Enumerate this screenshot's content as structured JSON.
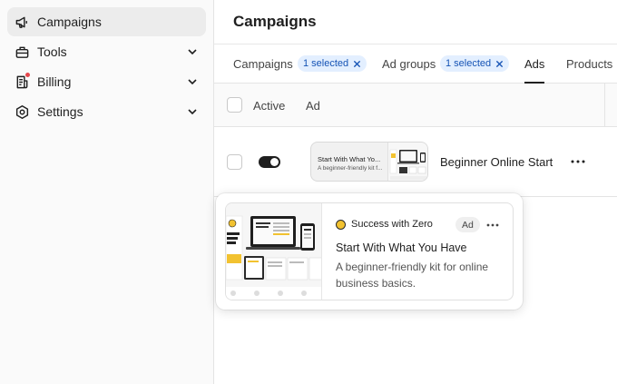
{
  "sidebar": {
    "items": [
      {
        "label": "Campaigns",
        "icon": "megaphone-icon",
        "active": true
      },
      {
        "label": "Tools",
        "icon": "toolbox-icon",
        "expandable": true
      },
      {
        "label": "Billing",
        "icon": "receipt-icon",
        "expandable": true,
        "has_notification": true
      },
      {
        "label": "Settings",
        "icon": "gear-icon",
        "expandable": true
      }
    ]
  },
  "main": {
    "title": "Campaigns",
    "tabs": [
      {
        "label": "Campaigns",
        "chip": "1 selected"
      },
      {
        "label": "Ad groups",
        "chip": "1 selected"
      },
      {
        "label": "Ads",
        "active": true
      },
      {
        "label": "Products"
      }
    ],
    "table": {
      "columns": [
        "Active",
        "Ad"
      ],
      "rows": [
        {
          "active": true,
          "thumb_title": "Start With What Yo...",
          "thumb_subtitle": "A beginner-friendly kit f...",
          "name": "Beginner Online Start"
        }
      ]
    }
  },
  "preview": {
    "brand": "Success with Zero",
    "badge": "Ad",
    "title": "Start With What You Have",
    "description": "A beginner-friendly kit for online business basics."
  },
  "colors": {
    "accent_chip_bg": "#e3efff",
    "accent_chip_text": "#1553b5",
    "notification": "#e5484d",
    "brand_yellow": "#f2c230"
  }
}
